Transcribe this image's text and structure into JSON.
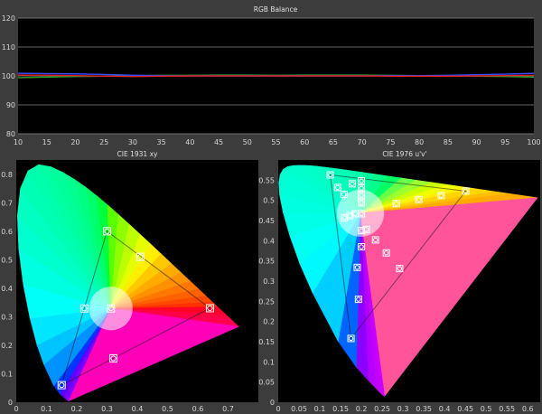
{
  "chart_data": [
    {
      "type": "line",
      "title": "RGB Balance",
      "x": [
        10,
        15,
        20,
        25,
        30,
        35,
        40,
        45,
        50,
        55,
        60,
        65,
        70,
        75,
        80,
        85,
        90,
        95,
        100
      ],
      "x_ticks": [
        10,
        15,
        20,
        25,
        30,
        35,
        40,
        45,
        50,
        55,
        60,
        65,
        70,
        75,
        80,
        85,
        90,
        95,
        100
      ],
      "y_ticks": [
        80,
        90,
        100,
        110,
        120
      ],
      "xlim": [
        10,
        100
      ],
      "ylim": [
        80,
        120
      ],
      "grid": true,
      "series": [
        {
          "color": "#2aa02a",
          "values": [
            99.4,
            99.6,
            99.8,
            99.9,
            100.1,
            100.2,
            100.2,
            100.3,
            100.3,
            100.2,
            100.3,
            100.3,
            100.3,
            100.2,
            100.1,
            100.0,
            99.9,
            99.8,
            99.6
          ]
        },
        {
          "color": "#3a4cff",
          "values": [
            100.9,
            100.8,
            100.7,
            100.5,
            100.2,
            100.1,
            100.0,
            100.0,
            100.0,
            100.0,
            100.0,
            100.0,
            100.0,
            100.1,
            100.1,
            100.2,
            100.4,
            100.6,
            100.9
          ]
        },
        {
          "color": "#e02020",
          "values": [
            100.3,
            100.2,
            100.1,
            99.9,
            99.8,
            99.9,
            100.0,
            100.0,
            100.0,
            100.0,
            100.0,
            100.0,
            100.0,
            99.9,
            99.9,
            99.9,
            100.0,
            100.1,
            100.2
          ]
        }
      ]
    },
    {
      "type": "scatter",
      "title": "CIE 1931 xy",
      "xlim": [
        0,
        0.8
      ],
      "ylim": [
        0,
        0.85
      ],
      "x_ticks": [
        "0",
        "0.1",
        "0.2",
        "0.3",
        "0.4",
        "0.5",
        "0.6",
        "0.7"
      ],
      "y_ticks": [
        "0",
        "0.1",
        "0.2",
        "0.3",
        "0.4",
        "0.5",
        "0.6",
        "0.7",
        "0.8"
      ],
      "gamut_triangle": [
        [
          0.64,
          0.33
        ],
        [
          0.3,
          0.6
        ],
        [
          0.15,
          0.06
        ]
      ],
      "targets": [
        [
          0.64,
          0.33
        ],
        [
          0.3,
          0.6
        ],
        [
          0.15,
          0.06
        ],
        [
          0.225,
          0.329
        ],
        [
          0.41,
          0.51
        ],
        [
          0.321,
          0.154
        ],
        [
          0.3127,
          0.329
        ]
      ],
      "measured": [
        [
          0.64,
          0.33
        ],
        [
          0.3,
          0.6
        ],
        [
          0.15,
          0.06
        ],
        [
          0.225,
          0.329
        ],
        [
          0.41,
          0.51
        ],
        [
          0.321,
          0.154
        ],
        [
          0.313,
          0.33
        ]
      ]
    },
    {
      "type": "scatter",
      "title": "CIE 1976 u'v'",
      "xlim": [
        0,
        0.63
      ],
      "ylim": [
        0,
        0.6
      ],
      "x_ticks": [
        "0",
        "0.05",
        "0.1",
        "0.15",
        "0.2",
        "0.25",
        "0.3",
        "0.35",
        "0.4",
        "0.45",
        "0.5",
        "0.55",
        "0.6"
      ],
      "y_ticks": [
        "0",
        "0.05",
        "0.1",
        "0.15",
        "0.2",
        "0.25",
        "0.3",
        "0.35",
        "0.4",
        "0.45",
        "0.5",
        "0.55"
      ],
      "gamut_triangle": [
        [
          0.451,
          0.523
        ],
        [
          0.125,
          0.563
        ],
        [
          0.175,
          0.158
        ]
      ],
      "targets": [
        [
          0.451,
          0.523
        ],
        [
          0.125,
          0.563
        ],
        [
          0.175,
          0.158
        ],
        [
          0.392,
          0.512
        ],
        [
          0.338,
          0.502
        ],
        [
          0.284,
          0.492
        ],
        [
          0.159,
          0.457
        ],
        [
          0.172,
          0.462
        ],
        [
          0.185,
          0.467
        ],
        [
          0.292,
          0.331
        ],
        [
          0.26,
          0.37
        ],
        [
          0.234,
          0.402
        ],
        [
          0.212,
          0.428
        ],
        [
          0.193,
          0.255
        ],
        [
          0.19,
          0.334
        ],
        [
          0.2,
          0.385
        ],
        [
          0.2,
          0.425
        ],
        [
          0.2,
          0.467
        ],
        [
          0.2,
          0.548
        ],
        [
          0.2,
          0.53
        ],
        [
          0.2,
          0.512
        ],
        [
          0.2,
          0.494
        ],
        [
          0.178,
          0.541
        ],
        [
          0.158,
          0.515
        ],
        [
          0.143,
          0.532
        ]
      ],
      "measured": [
        [
          0.451,
          0.523
        ],
        [
          0.125,
          0.563
        ],
        [
          0.175,
          0.158
        ],
        [
          0.392,
          0.512
        ],
        [
          0.338,
          0.502
        ],
        [
          0.284,
          0.492
        ],
        [
          0.159,
          0.457
        ],
        [
          0.172,
          0.462
        ],
        [
          0.185,
          0.467
        ],
        [
          0.292,
          0.331
        ],
        [
          0.26,
          0.37
        ],
        [
          0.234,
          0.402
        ],
        [
          0.212,
          0.428
        ],
        [
          0.193,
          0.255
        ],
        [
          0.19,
          0.334
        ],
        [
          0.2,
          0.385
        ],
        [
          0.2,
          0.425
        ],
        [
          0.2,
          0.467
        ],
        [
          0.2,
          0.548
        ],
        [
          0.2,
          0.53
        ],
        [
          0.2,
          0.512
        ],
        [
          0.2,
          0.494
        ],
        [
          0.178,
          0.541
        ],
        [
          0.158,
          0.515
        ],
        [
          0.143,
          0.532
        ]
      ]
    }
  ],
  "colors": {
    "panel_bg": "#3c3c3c",
    "plot_bg": "#000000",
    "grid": "#8a8a8a",
    "marker": "#ffffff"
  }
}
